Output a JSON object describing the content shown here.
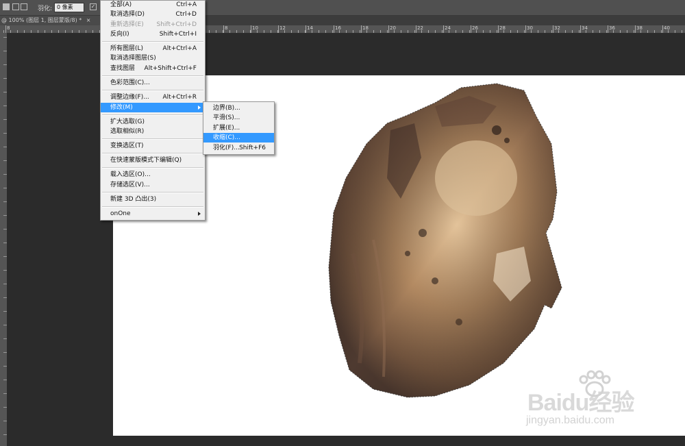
{
  "options_bar": {
    "feather_label": "羽化:",
    "feather_value": "0 像素"
  },
  "document_tab": {
    "title": "@ 100% (图层 1, 图层蒙版/8) *",
    "close": "×"
  },
  "ruler": {
    "labels": [
      "8",
      "6",
      "2",
      "4",
      "6",
      "8",
      "10",
      "12",
      "14",
      "16",
      "18",
      "20",
      "22",
      "24",
      "26",
      "28",
      "30",
      "32",
      "34",
      "36",
      "38",
      "40"
    ]
  },
  "select_menu": {
    "items": [
      {
        "label": "全部(A)",
        "shortcut": "Ctrl+A"
      },
      {
        "label": "取消选择(D)",
        "shortcut": "Ctrl+D"
      },
      {
        "label": "重新选择(E)",
        "shortcut": "Shift+Ctrl+D",
        "disabled": true
      },
      {
        "label": "反向(I)",
        "shortcut": "Shift+Ctrl+I"
      },
      {
        "label": "所有图层(L)",
        "shortcut": "Alt+Ctrl+A"
      },
      {
        "label": "取消选择图层(S)",
        "shortcut": ""
      },
      {
        "label": "查找图层",
        "shortcut": "Alt+Shift+Ctrl+F"
      },
      {
        "label": "色彩范围(C)...",
        "shortcut": ""
      },
      {
        "label": "调整边缘(F)...",
        "shortcut": "Alt+Ctrl+R"
      },
      {
        "label": "修改(M)",
        "shortcut": "",
        "submenu": true,
        "highlighted": true
      },
      {
        "label": "扩大选取(G)",
        "shortcut": ""
      },
      {
        "label": "选取相似(R)",
        "shortcut": ""
      },
      {
        "label": "变换选区(T)",
        "shortcut": ""
      },
      {
        "label": "在快速蒙版模式下编辑(Q)",
        "shortcut": ""
      },
      {
        "label": "载入选区(O)...",
        "shortcut": ""
      },
      {
        "label": "存储选区(V)...",
        "shortcut": ""
      },
      {
        "label": "新建 3D 凸出(3)",
        "shortcut": ""
      },
      {
        "label": "onOne",
        "shortcut": "",
        "submenu": true
      }
    ]
  },
  "modify_submenu": {
    "items": [
      {
        "label": "边界(B)...",
        "shortcut": ""
      },
      {
        "label": "平滑(S)...",
        "shortcut": ""
      },
      {
        "label": "扩展(E)...",
        "shortcut": ""
      },
      {
        "label": "收缩(C)...",
        "shortcut": "",
        "highlighted": true
      },
      {
        "label": "羽化(F)...",
        "shortcut": "Shift+F6"
      }
    ]
  },
  "watermark": {
    "brand": "Baidu经验",
    "url": "jingyan.baidu.com"
  }
}
